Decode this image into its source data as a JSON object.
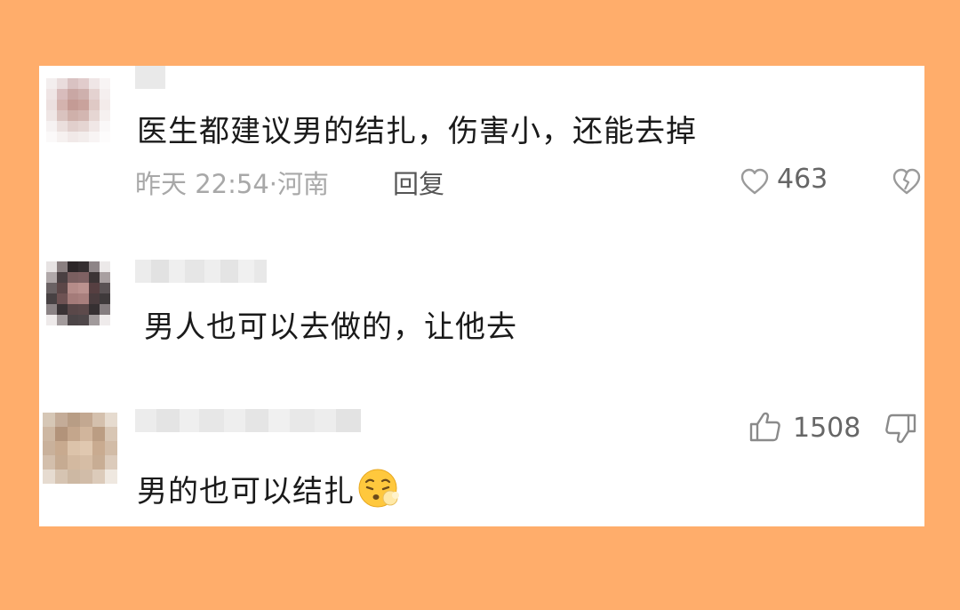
{
  "comments": [
    {
      "text": "医生都建议男的结扎，伤害小，还能去掉",
      "time": "昨天 22:54",
      "location": "河南",
      "reply_label": "回复",
      "likes": "463"
    },
    {
      "text": "男人也可以去做的，让他去"
    },
    {
      "text": "男的也可以结扎",
      "likes": "1508"
    }
  ],
  "icons": {
    "heart": "heart-icon",
    "broken_heart": "broken-heart-icon",
    "thumbs_up": "thumbs-up-icon",
    "thumbs_down": "thumbs-down-icon",
    "emoji": "face-emoji"
  },
  "colors": {
    "background": "#FFAD6B",
    "panel": "#FFFFFF",
    "text": "#1A1A1A",
    "meta": "#A8A8A8"
  }
}
